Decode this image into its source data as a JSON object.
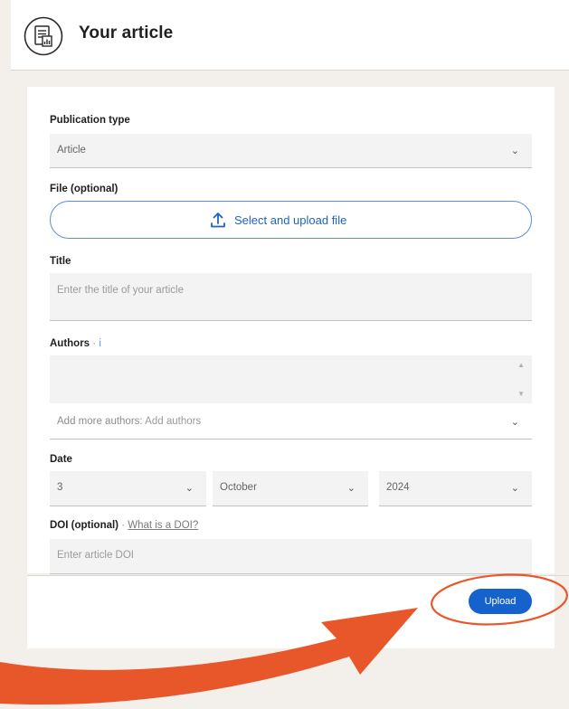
{
  "header": {
    "title": "Your article",
    "icon": "article-document-icon"
  },
  "form": {
    "publication_type": {
      "label": "Publication type",
      "value": "Article"
    },
    "file": {
      "label": "File (optional)",
      "button_label": "Select and upload file",
      "icon": "upload-icon"
    },
    "title": {
      "label": "Title",
      "placeholder": "Enter the title of your article"
    },
    "authors": {
      "label": "Authors",
      "separator": "·",
      "info_icon": "i",
      "add_more_label": "Add more authors:",
      "add_placeholder": "Add authors"
    },
    "date": {
      "label": "Date",
      "day": "3",
      "month": "October",
      "year": "2024"
    },
    "doi": {
      "label": "DOI (optional)",
      "separator": "·",
      "help_link": "What is a DOI?",
      "placeholder": "Enter article DOI"
    }
  },
  "footer": {
    "upload_label": "Upload"
  },
  "colors": {
    "background": "#f3efea",
    "primary": "#1662cc",
    "annotation": "#e8572a"
  }
}
